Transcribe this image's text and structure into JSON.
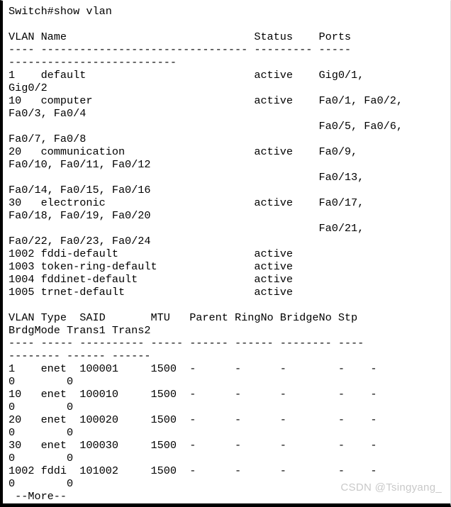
{
  "terminal": {
    "hostname": "Switch",
    "prompt_symbol": "#",
    "command": "show vlan",
    "prompt_line": "Switch#show vlan",
    "more_prompt": " --More--",
    "wrap_columns": 62,
    "colors": {
      "background": "#ffffff",
      "text": "#000000",
      "border": "#000000",
      "watermark": "#c9c9c9"
    }
  },
  "watermark": {
    "text": "CSDN @Tsingyang_"
  },
  "vlan_table": {
    "headers": [
      "VLAN",
      "Name",
      "Status",
      "Ports"
    ],
    "header_line": "VLAN Name                             Status    Ports",
    "separator_line": "---- -------------------------------- --------- -------------------------------",
    "rows": [
      {
        "vlan": "1",
        "name": "default",
        "status": "active",
        "ports": [
          "Gig0/1",
          "Gig0/2"
        ]
      },
      {
        "vlan": "10",
        "name": "computer",
        "status": "active",
        "ports": [
          "Fa0/1",
          "Fa0/2",
          "Fa0/3",
          "Fa0/4",
          "Fa0/5",
          "Fa0/6",
          "Fa0/7",
          "Fa0/8"
        ]
      },
      {
        "vlan": "20",
        "name": "communication",
        "status": "active",
        "ports": [
          "Fa0/9",
          "Fa0/10",
          "Fa0/11",
          "Fa0/12",
          "Fa0/13",
          "Fa0/14",
          "Fa0/15",
          "Fa0/16"
        ]
      },
      {
        "vlan": "30",
        "name": "electronic",
        "status": "active",
        "ports": [
          "Fa0/17",
          "Fa0/18",
          "Fa0/19",
          "Fa0/20",
          "Fa0/21",
          "Fa0/22",
          "Fa0/23",
          "Fa0/24"
        ]
      },
      {
        "vlan": "1002",
        "name": "fddi-default",
        "status": "active",
        "ports": []
      },
      {
        "vlan": "1003",
        "name": "token-ring-default",
        "status": "active",
        "ports": []
      },
      {
        "vlan": "1004",
        "name": "fddinet-default",
        "status": "active",
        "ports": []
      },
      {
        "vlan": "1005",
        "name": "trnet-default",
        "status": "active",
        "ports": []
      }
    ]
  },
  "vlan_detail_table": {
    "headers": [
      "VLAN",
      "Type",
      "SAID",
      "MTU",
      "Parent",
      "RingNo",
      "BridgeNo",
      "Stp",
      "BrdgMode",
      "Trans1",
      "Trans2"
    ],
    "header_line": "VLAN Type  SAID       MTU   Parent RingNo BridgeNo Stp  BrdgMode Trans1 Trans2",
    "separator_line": "---- ----- ---------- ----- ------ ------ -------- ---- -------- ------ ------",
    "rows": [
      {
        "vlan": "1",
        "type": "enet",
        "said": "100001",
        "mtu": "1500",
        "parent": "-",
        "ringno": "-",
        "bridgeno": "-",
        "stp": "-",
        "brdgmode": "-",
        "trans1": "0",
        "trans2": "0"
      },
      {
        "vlan": "10",
        "type": "enet",
        "said": "100010",
        "mtu": "1500",
        "parent": "-",
        "ringno": "-",
        "bridgeno": "-",
        "stp": "-",
        "brdgmode": "-",
        "trans1": "0",
        "trans2": "0"
      },
      {
        "vlan": "20",
        "type": "enet",
        "said": "100020",
        "mtu": "1500",
        "parent": "-",
        "ringno": "-",
        "bridgeno": "-",
        "stp": "-",
        "brdgmode": "-",
        "trans1": "0",
        "trans2": "0"
      },
      {
        "vlan": "30",
        "type": "enet",
        "said": "100030",
        "mtu": "1500",
        "parent": "-",
        "ringno": "-",
        "bridgeno": "-",
        "stp": "-",
        "brdgmode": "-",
        "trans1": "0",
        "trans2": "0"
      },
      {
        "vlan": "1002",
        "type": "fddi",
        "said": "101002",
        "mtu": "1500",
        "parent": "-",
        "ringno": "-",
        "bridgeno": "-",
        "stp": "-",
        "brdgmode": "-",
        "trans1": "0",
        "trans2": "0"
      }
    ]
  },
  "rendered_lines": [
    "Switch#show vlan",
    "",
    "VLAN Name                             Status    Ports",
    "---- -------------------------------- --------- -----",
    "--------------------------",
    "1    default                          active    Gig0/1,",
    "Gig0/2",
    "10   computer                         active    Fa0/1, Fa0/2,",
    "Fa0/3, Fa0/4",
    "                                                Fa0/5, Fa0/6,",
    "Fa0/7, Fa0/8",
    "20   communication                    active    Fa0/9,",
    "Fa0/10, Fa0/11, Fa0/12",
    "                                                Fa0/13,",
    "Fa0/14, Fa0/15, Fa0/16",
    "30   electronic                       active    Fa0/17,",
    "Fa0/18, Fa0/19, Fa0/20",
    "                                                Fa0/21,",
    "Fa0/22, Fa0/23, Fa0/24",
    "1002 fddi-default                     active",
    "1003 token-ring-default               active",
    "1004 fddinet-default                  active",
    "1005 trnet-default                    active",
    "",
    "VLAN Type  SAID       MTU   Parent RingNo BridgeNo Stp",
    "BrdgMode Trans1 Trans2",
    "---- ----- ---------- ----- ------ ------ -------- ----",
    "-------- ------ ------",
    "1    enet  100001     1500  -      -      -        -    -",
    "0        0",
    "10   enet  100010     1500  -      -      -        -    -",
    "0        0",
    "20   enet  100020     1500  -      -      -        -    -",
    "0        0",
    "30   enet  100030     1500  -      -      -        -    -",
    "0        0",
    "1002 fddi  101002     1500  -      -      -        -    -",
    "0        0",
    " --More--"
  ]
}
